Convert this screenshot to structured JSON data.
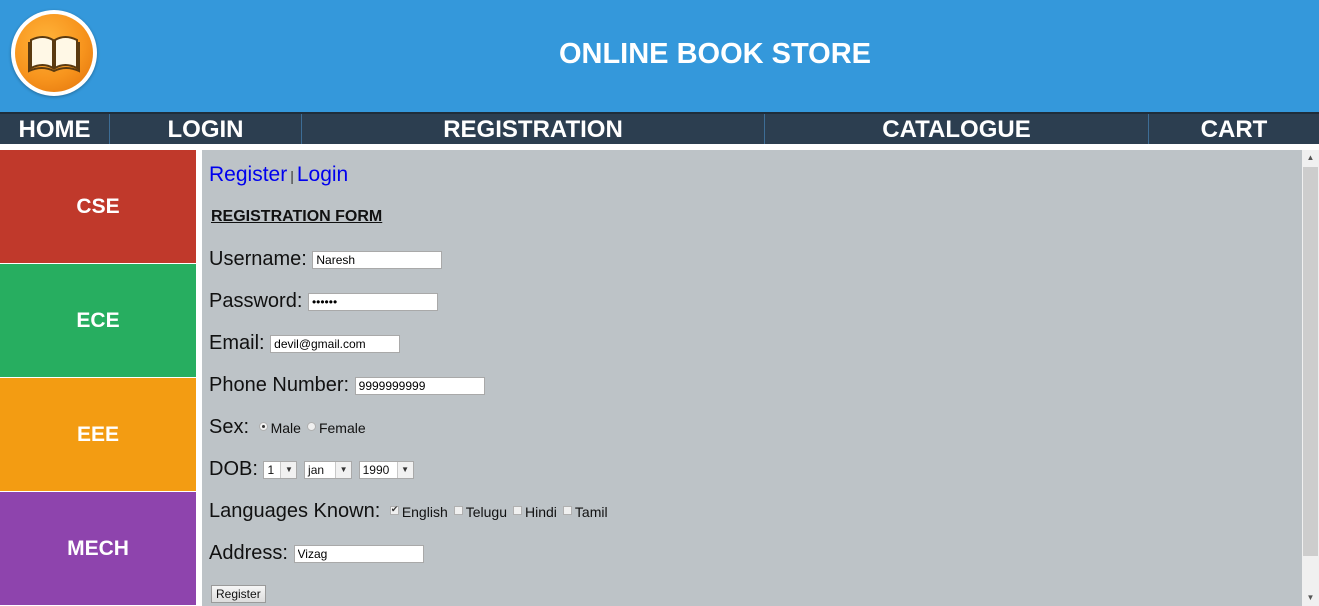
{
  "header": {
    "site_title": "ONLINE BOOK STORE",
    "logo_icon": "open-book-icon",
    "background": "#3498db"
  },
  "nav": {
    "items": [
      "HOME",
      "LOGIN",
      "REGISTRATION",
      "CATALOGUE",
      "CART"
    ],
    "background": "#2c3e50"
  },
  "sidebar": {
    "items": [
      {
        "label": "CSE",
        "color": "#c0392b"
      },
      {
        "label": "ECE",
        "color": "#27ae60"
      },
      {
        "label": "EEE",
        "color": "#f39c12"
      },
      {
        "label": "MECH",
        "color": "#8e44ad"
      }
    ]
  },
  "main": {
    "background": "#bdc3c7",
    "tabs": {
      "register": "Register",
      "separator": "|",
      "login": "Login"
    },
    "form_title": "REGISTRATION FORM",
    "username": {
      "label": "Username:",
      "value": "Naresh"
    },
    "password": {
      "label": "Password:",
      "value": "••••••"
    },
    "email": {
      "label": "Email:",
      "value": "devil@gmail.com"
    },
    "phone": {
      "label": "Phone Number:",
      "value": "9999999999"
    },
    "sex": {
      "label": "Sex:",
      "options": [
        "Male",
        "Female"
      ],
      "selected": "Male"
    },
    "dob": {
      "label": "DOB:",
      "day": "1",
      "month": "jan",
      "year": "1990"
    },
    "languages": {
      "label": "Languages Known:",
      "options": [
        "English",
        "Telugu",
        "Hindi",
        "Tamil"
      ],
      "checked": [
        "English"
      ]
    },
    "address": {
      "label": "Address:",
      "value": "Vizag"
    },
    "submit_label": "Register"
  }
}
